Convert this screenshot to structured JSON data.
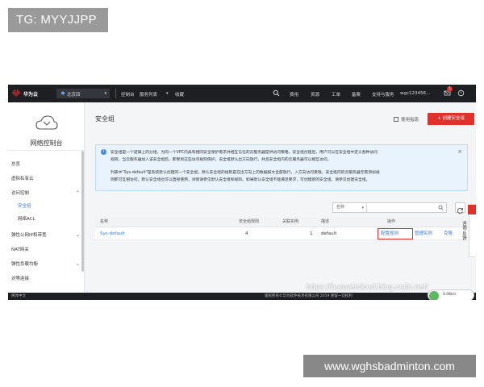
{
  "watermark_tag": "TG: MYYJJPP",
  "site_banner": "www.wghsbadminton.com",
  "overlay_url": "https://huaweicloud.blog.csdn.net/",
  "topbar": {
    "brand": "华为云",
    "region": "北京四",
    "nav": [
      "控制台",
      "服务列表",
      "收藏"
    ],
    "right_links": [
      "费用",
      "资源",
      "工单",
      "备案",
      "支持与服务"
    ],
    "account": "wgc123456...",
    "notification_count": "1"
  },
  "sidebar": {
    "title": "网络控制台",
    "items": [
      {
        "label": "总览"
      },
      {
        "label": "虚拟私有云"
      },
      {
        "label": "访问控制"
      },
      {
        "label": "安全组"
      },
      {
        "label": "网络ACL"
      },
      {
        "label": "弹性公网IP和带宽"
      },
      {
        "label": "NAT网关"
      },
      {
        "label": "弹性负载均衡"
      },
      {
        "label": "对等连接"
      }
    ]
  },
  "main": {
    "title": "安全组",
    "guide_label": "使用指南",
    "create_label": "+ 创建安全组",
    "info_lines": [
      "安全组是一个逻辑上的分组，为同一个VPC内具有相同安全保护需求并相互信任的云服务器提供访问策略。安全组创建后，用户可以在安全组中定义各种访问",
      "规则，当云服务器加入该安全组后，即受到这些访问规则保护。安全组默认出方向放行，并且安全组内的云服务器可以相互访问。",
      "列表中\"Sys-default\"是系统默认创建的一个安全组，默认安全组的规则是在出方向上的数据报文全部放行，入方向访问受限，安全组内的云服务器无需添加规",
      "则即可互相访问。默认安全组也可以直接使用，详情请参见默认安全组和规则。如果默认安全组不能满足要求，可创建新的安全组，请参见创建安全组。"
    ],
    "filter_select": "名称",
    "columns": [
      "名称",
      "安全组规则",
      "关联实例",
      "描述",
      "操作"
    ],
    "rows": [
      {
        "name": "Sys-default",
        "rules": "4",
        "instances": "1",
        "desc": "default",
        "op_configure": "配置规则",
        "op_manage": "管理实例",
        "op_clone": "克隆"
      }
    ]
  },
  "float_tab": "咨询·反馈",
  "bottombar": {
    "left": "简体中文",
    "middle": "版权所有©华为软件技术有限公司 2019 保留一切权利"
  },
  "mini_widget": "0.06k/s"
}
